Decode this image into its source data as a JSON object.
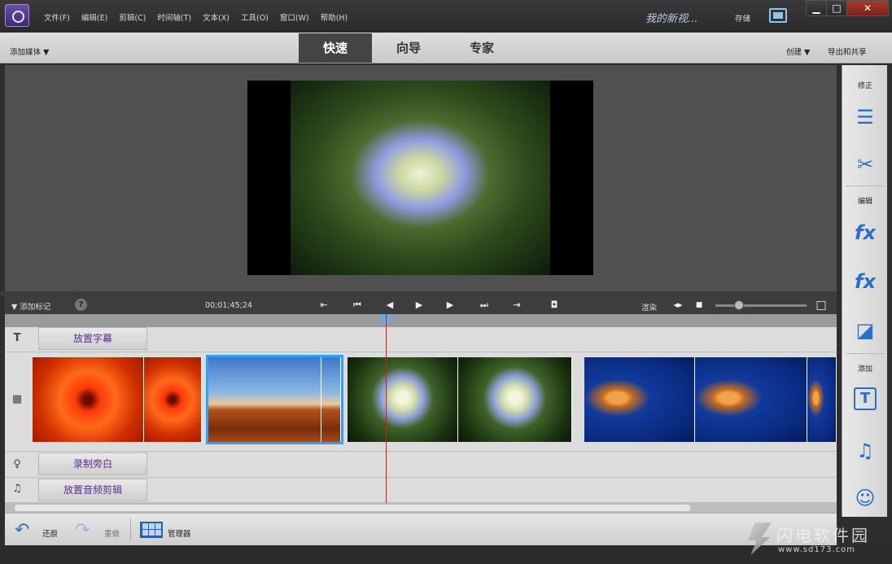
{
  "menu": {
    "items": [
      "文件(F)",
      "编辑(E)",
      "剪辑(C)",
      "时间轴(T)",
      "文本(X)",
      "工具(O)",
      "窗口(W)",
      "帮助(H)"
    ]
  },
  "header": {
    "project_title": "我的新视...",
    "save_label": "存储"
  },
  "modebar": {
    "add_media": "添加媒体",
    "tabs": [
      {
        "label": "快速",
        "active": true
      },
      {
        "label": "向导",
        "active": false
      },
      {
        "label": "专家",
        "active": false
      }
    ],
    "create": "创建",
    "export_share": "导出和共享"
  },
  "transport": {
    "add_marker": "添加标记",
    "help": "?",
    "timecode": "00;01;45;24",
    "render": "渲染"
  },
  "timeline": {
    "title_lane": "放置字幕",
    "narration_lane": "录制旁白",
    "audio_lane": "放置音频剪辑",
    "clips": [
      "flower-red",
      "desert",
      "hydrangea",
      "jellyfish"
    ],
    "selected_clip": "desert"
  },
  "bottombar": {
    "undo": "还原",
    "redo": "重做",
    "organizer": "管理器"
  },
  "rightpanel": {
    "adjust_header": "修正",
    "edit_header": "编辑",
    "add_header": "添加"
  },
  "watermark": {
    "brand": "闪电软件园",
    "url": "www.sd173.com"
  },
  "colors": {
    "accent": "#2a6fc7",
    "selection": "#2aa0ff",
    "playhead": "#e11111",
    "lane_text": "#5b2e86"
  }
}
